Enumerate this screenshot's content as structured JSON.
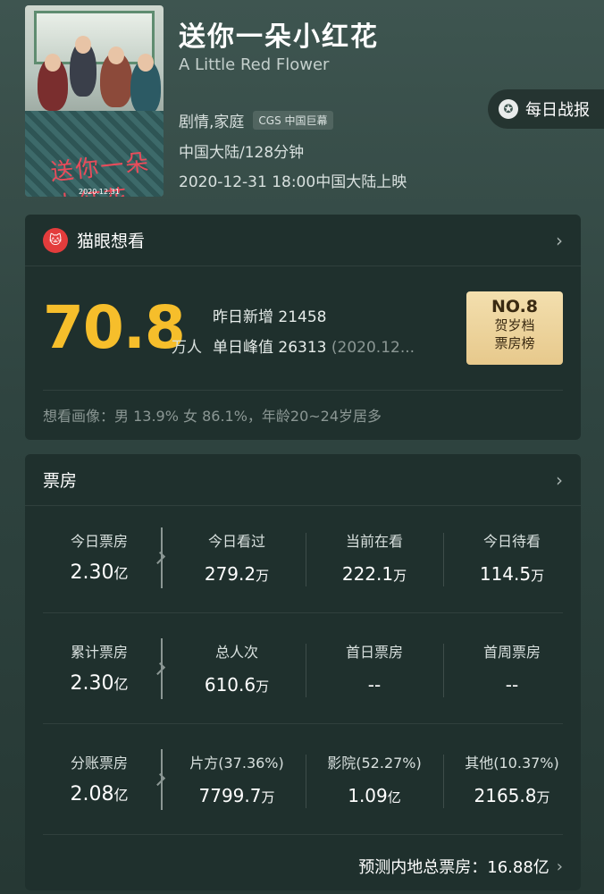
{
  "movie": {
    "title": "送你一朵小红花",
    "english_title": "A Little Red Flower",
    "genre": "剧情,家庭",
    "format_tag": "CGS 中国巨幕",
    "region_duration": "中国大陆/128分钟",
    "release": "2020-12-31 18:00中国大陆上映",
    "poster": {
      "title_script": "送你一朵小红花",
      "date": "2020.12.31"
    }
  },
  "daily_report_button": "每日战报",
  "want": {
    "header": "猫眼想看",
    "count": "70.8",
    "unit": "万人",
    "yesterday_label": "昨日新增",
    "yesterday_value": "21458",
    "peak_label": "单日峰值",
    "peak_value": "26313",
    "peak_date": "(2020.12...",
    "rank_no": "NO.8",
    "rank_line2": "贺岁档",
    "rank_line3": "票房榜",
    "portrait": "想看画像：男 13.9%  女 86.1%，年龄20~24岁居多"
  },
  "box_office": {
    "header": "票房",
    "rows": [
      {
        "main_label": "今日票房",
        "main_value": "2.30",
        "main_unit": "亿",
        "subs": [
          {
            "label": "今日看过",
            "value": "279.2",
            "unit": "万"
          },
          {
            "label": "当前在看",
            "value": "222.1",
            "unit": "万"
          },
          {
            "label": "今日待看",
            "value": "114.5",
            "unit": "万"
          }
        ]
      },
      {
        "main_label": "累计票房",
        "main_value": "2.30",
        "main_unit": "亿",
        "subs": [
          {
            "label": "总人次",
            "value": "610.6",
            "unit": "万"
          },
          {
            "label": "首日票房",
            "value": "--",
            "unit": ""
          },
          {
            "label": "首周票房",
            "value": "--",
            "unit": ""
          }
        ]
      },
      {
        "main_label": "分账票房",
        "main_value": "2.08",
        "main_unit": "亿",
        "subs": [
          {
            "label": "片方(37.36%)",
            "value": "7799.7",
            "unit": "万"
          },
          {
            "label": "影院(52.27%)",
            "value": "1.09",
            "unit": "亿"
          },
          {
            "label": "其他(10.37%)",
            "value": "2165.8",
            "unit": "万"
          }
        ]
      }
    ],
    "forecast": "预测内地总票房：16.88亿"
  },
  "icons": {
    "chevron": "›",
    "cat_logo": "cat-icon",
    "report": "medal-icon"
  },
  "colors": {
    "accent_yellow": "#f6be2b",
    "badge_gold": "#e7c98c",
    "maoyan_red": "#e33c3c"
  }
}
